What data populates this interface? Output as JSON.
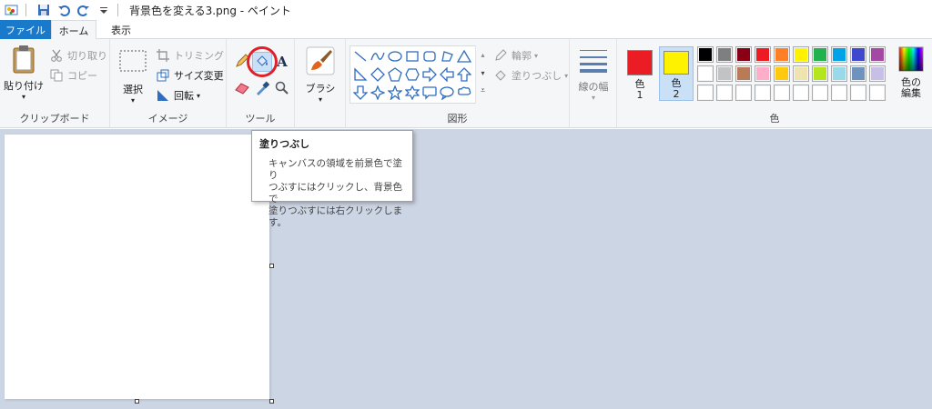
{
  "title_bar": {
    "title": "背景色を変える3.png - ペイント"
  },
  "tabs": {
    "file": "ファイル",
    "home": "ホーム",
    "view": "表示"
  },
  "clipboard": {
    "paste": "貼り付け",
    "cut": "切り取り",
    "copy": "コピー",
    "label": "クリップボード"
  },
  "image": {
    "select": "選択",
    "crop": "トリミング",
    "resize": "サイズ変更",
    "rotate": "回転",
    "label": "イメージ"
  },
  "tools": {
    "label": "ツール"
  },
  "brushes": {
    "label": "ブラシ"
  },
  "shapes": {
    "outline": "輪郭",
    "fill": "塗りつぶし",
    "label": "図形"
  },
  "size": {
    "label": "線の幅"
  },
  "colors": {
    "color1_label": "色\n1",
    "color1_word": "色",
    "color1_num": "1",
    "color2_word": "色",
    "color2_num": "2",
    "edit_word1": "色の",
    "edit_word2": "編集",
    "label": "色",
    "color1": "#ec1c24",
    "color2": "#fff200",
    "palette_row1": [
      "#000000",
      "#7f7f7f",
      "#880015",
      "#ed1c24",
      "#ff7f27",
      "#fff200",
      "#22b14c",
      "#00a2e8",
      "#3f48cc",
      "#a349a4"
    ],
    "palette_row2": [
      "#ffffff",
      "#c3c3c3",
      "#b97a57",
      "#ffaec9",
      "#ffc90e",
      "#efe4b0",
      "#b5e61d",
      "#99d9ea",
      "#7092be",
      "#c8bfe7"
    ]
  },
  "tooltip": {
    "title": "塗りつぶし",
    "body": "キャンバスの領域を前景色で塗り\nつぶすにはクリックし、背景色で\n塗りつぶすには右クリックします。"
  }
}
